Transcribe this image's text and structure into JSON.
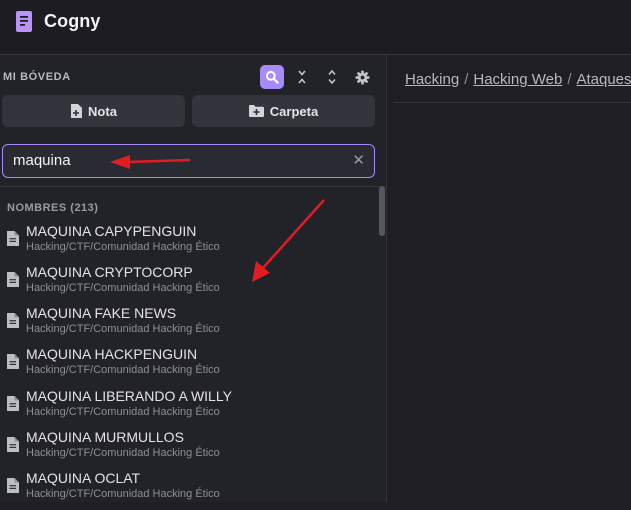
{
  "app": {
    "title": "Cogny"
  },
  "sidebar": {
    "vault_label": "MI BÓVEDA",
    "toolbar": {
      "search_icon": "search-icon",
      "collapse_icon": "collapse-all-icon",
      "expand_icon": "expand-all-icon",
      "settings_icon": "gear-icon"
    },
    "new_note_label": "Nota",
    "new_folder_label": "Carpeta",
    "search": {
      "value": "maquina"
    },
    "results_header": "NOMBRES (213)",
    "results": [
      {
        "title": "MAQUINA CAPYPENGUIN",
        "path": "Hacking/CTF/Comunidad Hacking Ético"
      },
      {
        "title": "MAQUINA CRYPTOCORP",
        "path": "Hacking/CTF/Comunidad Hacking Ético"
      },
      {
        "title": "MAQUINA FAKE NEWS",
        "path": "Hacking/CTF/Comunidad Hacking Ético"
      },
      {
        "title": "MAQUINA HACKPENGUIN",
        "path": "Hacking/CTF/Comunidad Hacking Ético"
      },
      {
        "title": "MAQUINA LIBERANDO A WILLY",
        "path": "Hacking/CTF/Comunidad Hacking Ético"
      },
      {
        "title": "MAQUINA MURMULLOS",
        "path": "Hacking/CTF/Comunidad Hacking Ético"
      },
      {
        "title": "MAQUINA OCLAT",
        "path": "Hacking/CTF/Comunidad Hacking Ético"
      }
    ]
  },
  "main": {
    "breadcrumb": [
      "Hacking",
      "Hacking Web",
      "Ataques"
    ],
    "separator": "/"
  },
  "colors": {
    "accent": "#a78bfa",
    "annotation_arrow": "#e11d24"
  }
}
